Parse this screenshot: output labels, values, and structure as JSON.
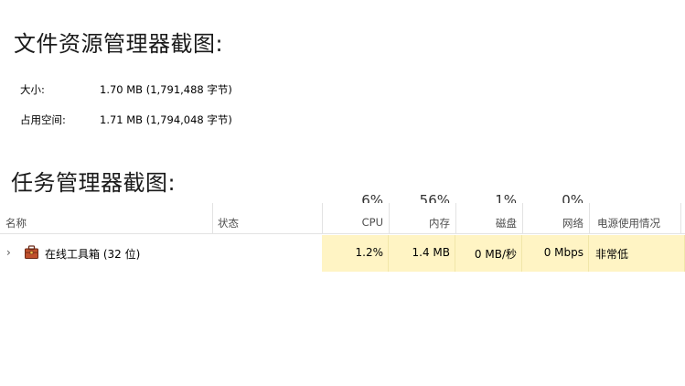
{
  "explorer": {
    "title": "文件资源管理器截图:",
    "size": {
      "label": "大小:",
      "value": "1.70 MB (1,791,488 字节)"
    },
    "disk": {
      "label": "占用空间:",
      "value": "1.71 MB (1,794,048 字节)"
    }
  },
  "taskmgr": {
    "title": "任务管理器截图:",
    "headers": {
      "name": "名称",
      "status": "状态",
      "cpu": "CPU",
      "cpu_pct": "6%",
      "memory": "内存",
      "memory_pct": "56%",
      "disk": "磁盘",
      "disk_pct": "1%",
      "network": "网络",
      "network_pct": "0%",
      "power": "电源使用情况"
    },
    "row": {
      "name": "在线工具箱 (32 位)",
      "cpu": "1.2%",
      "memory": "1.4 MB",
      "disk": "0 MB/秒",
      "network": "0 Mbps",
      "power": "非常低",
      "icon": "toolbox-icon"
    },
    "colors": {
      "highlight": "#fff4c4",
      "separator": "#e3e3e3",
      "icon": "#c0502d"
    }
  }
}
